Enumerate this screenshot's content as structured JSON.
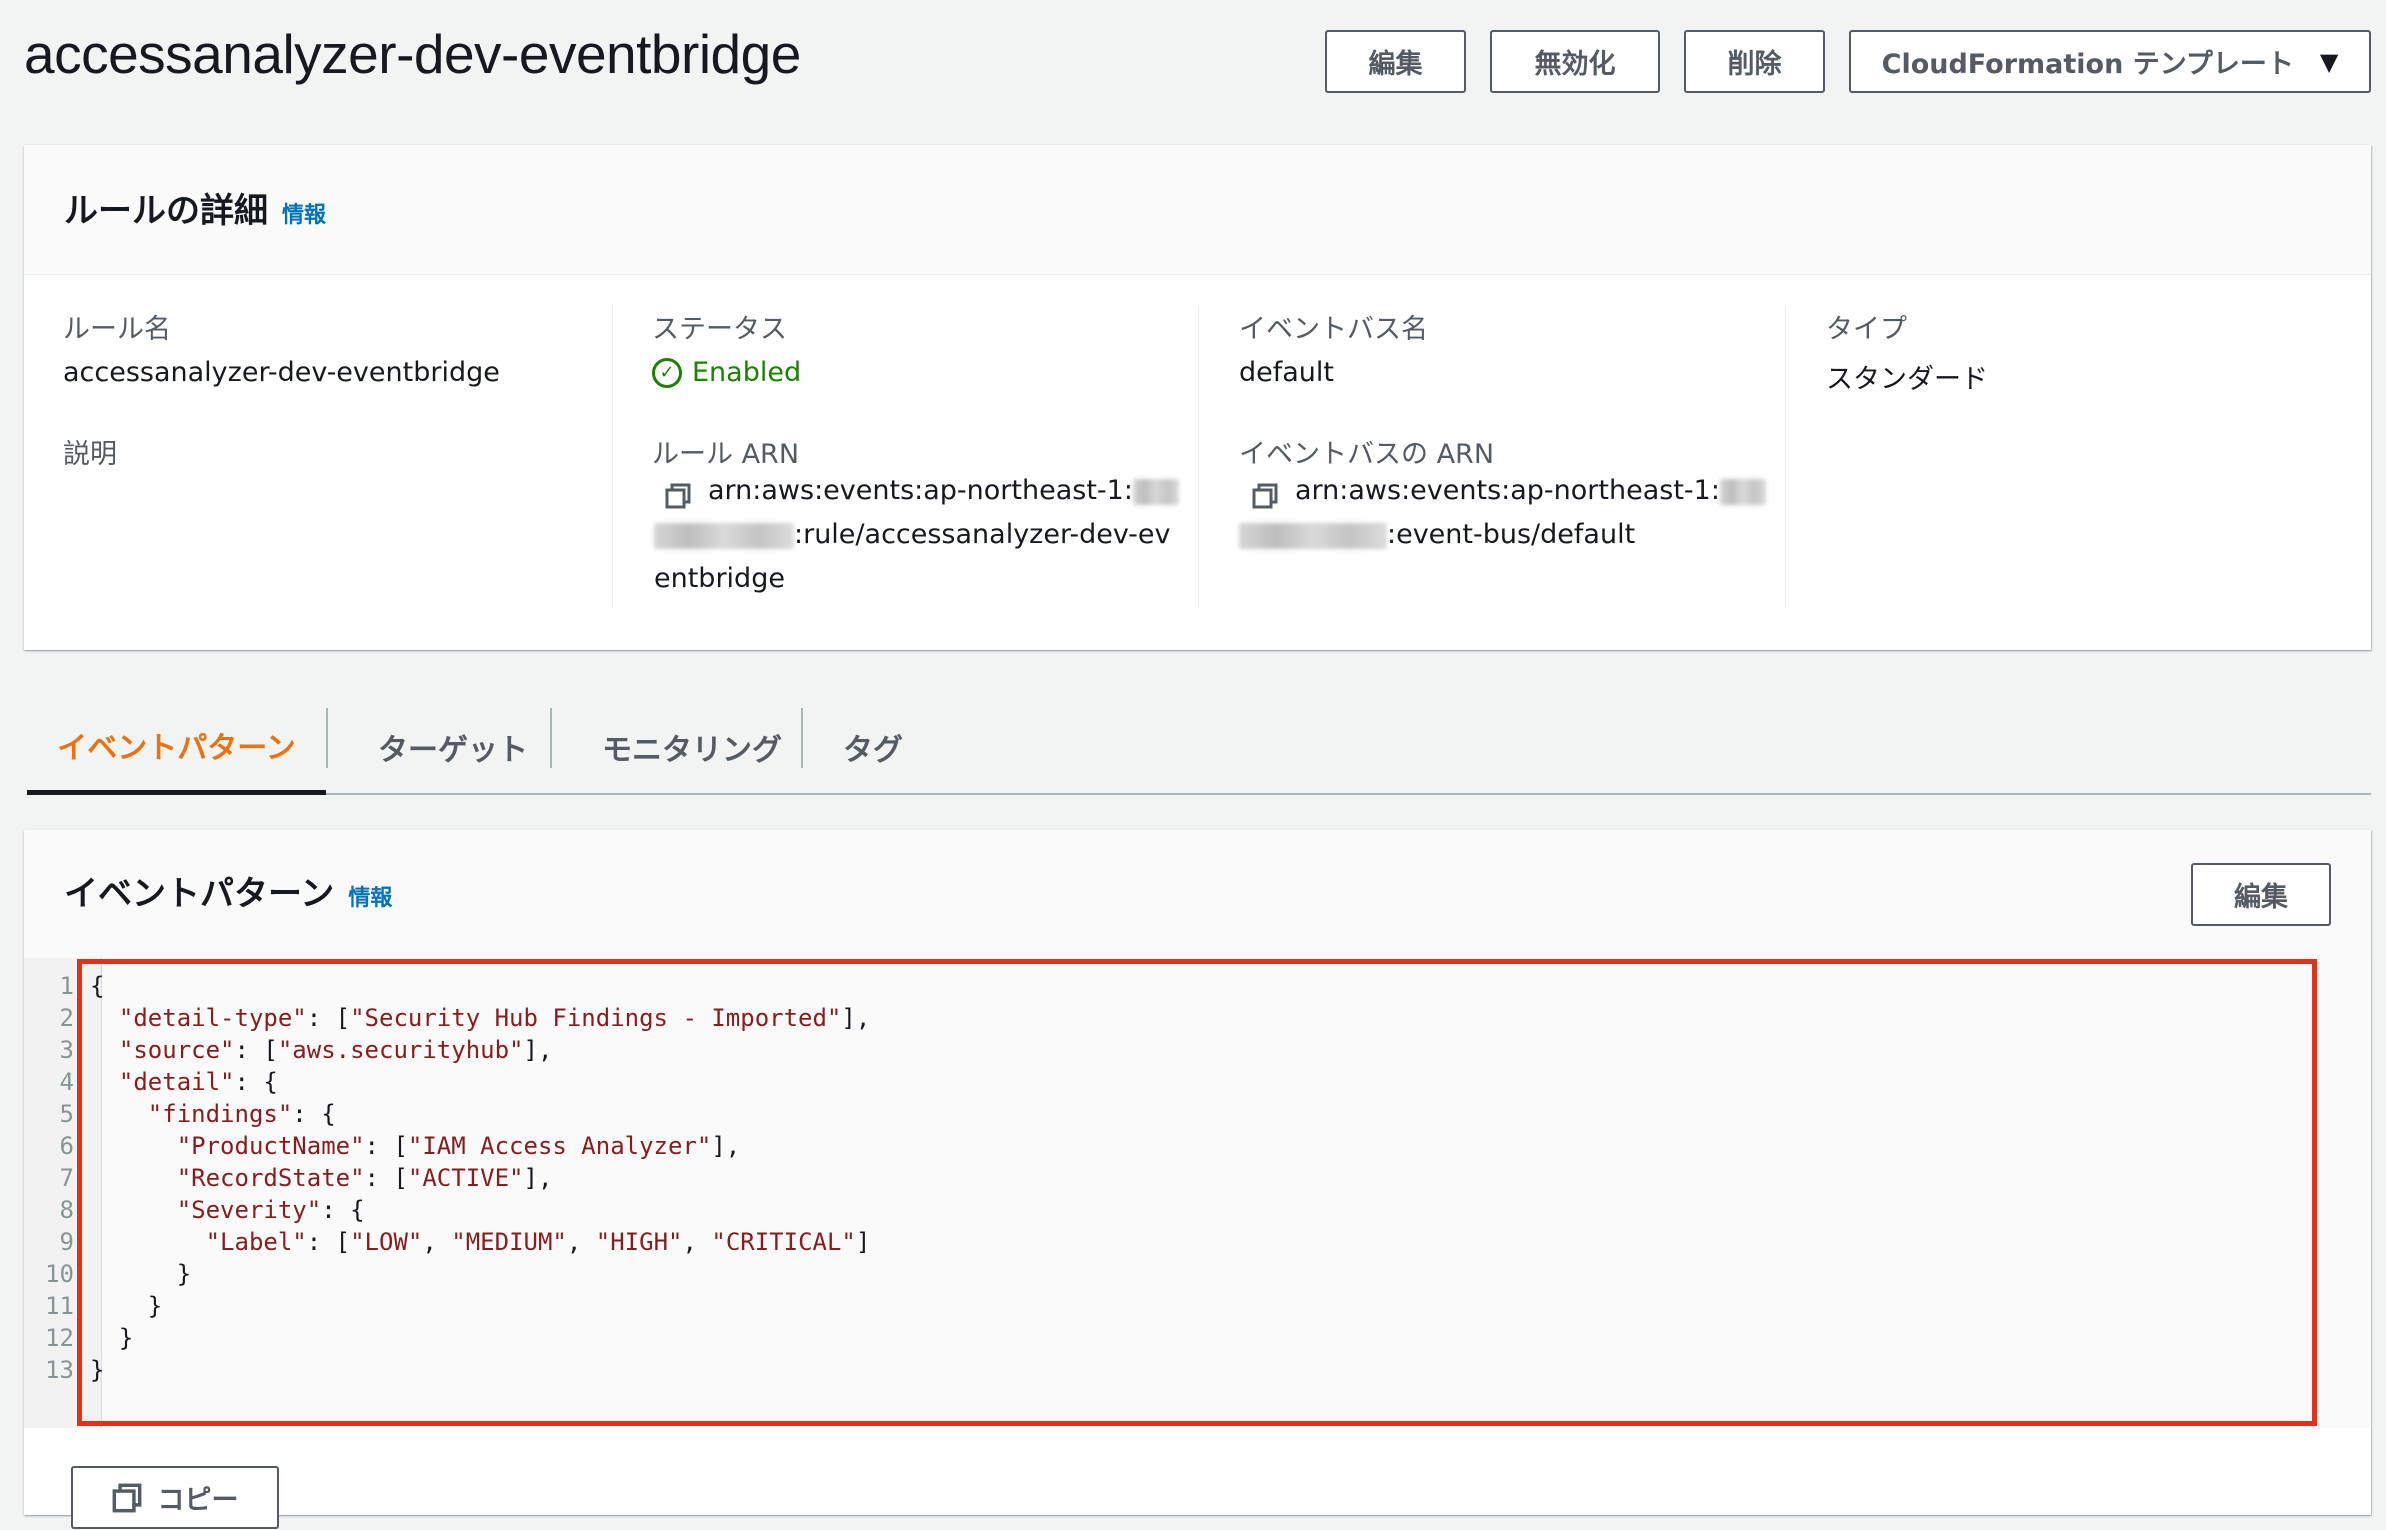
{
  "header": {
    "title": "accessanalyzer-dev-eventbridge",
    "buttons": {
      "edit": "編集",
      "disable": "無効化",
      "delete": "削除",
      "cloudformation": "CloudFormation テンプレート"
    }
  },
  "rule_details": {
    "title": "ルールの詳細",
    "info": "情報",
    "rule_name_label": "ルール名",
    "rule_name_value": "accessanalyzer-dev-eventbridge",
    "description_label": "説明",
    "status_label": "ステータス",
    "status_value": "Enabled",
    "rule_arn_label": "ルール ARN",
    "rule_arn_line1": "arn:aws:events:ap-northeast-1:",
    "rule_arn_line2": ":rule/accessanalyzer-dev-ev",
    "rule_arn_line3": "entbridge",
    "event_bus_label": "イベントバス名",
    "event_bus_value": "default",
    "event_bus_arn_label": "イベントバスの ARN",
    "event_bus_arn_line1": "arn:aws:events:ap-northeast-1:",
    "event_bus_arn_line2": ":event-bus/default",
    "type_label": "タイプ",
    "type_value": "スタンダード"
  },
  "tabs": [
    {
      "label": "イベントパターン",
      "active": true
    },
    {
      "label": "ターゲット",
      "active": false
    },
    {
      "label": "モニタリング",
      "active": false
    },
    {
      "label": "タグ",
      "active": false
    }
  ],
  "event_pattern": {
    "title": "イベントパターン",
    "info": "情報",
    "edit": "編集",
    "copy": "コピー",
    "line_numbers": [
      "1",
      "2",
      "3",
      "4",
      "5",
      "6",
      "7",
      "8",
      "9",
      "10",
      "11",
      "12",
      "13"
    ],
    "code_lines": [
      "{",
      "  \"detail-type\": [\"Security Hub Findings - Imported\"],",
      "  \"source\": [\"aws.securityhub\"],",
      "  \"detail\": {",
      "    \"findings\": {",
      "      \"ProductName\": [\"IAM Access Analyzer\"],",
      "      \"RecordState\": [\"ACTIVE\"],",
      "      \"Severity\": {",
      "        \"Label\": [\"LOW\", \"MEDIUM\", \"HIGH\", \"CRITICAL\"]",
      "      }",
      "    }",
      "  }",
      "}"
    ]
  },
  "colors": {
    "accent": "#ec7211",
    "link": "#0073bb",
    "success": "#1d8102",
    "highlight_border": "#e3321c",
    "code_string": "#8a1c1c"
  }
}
